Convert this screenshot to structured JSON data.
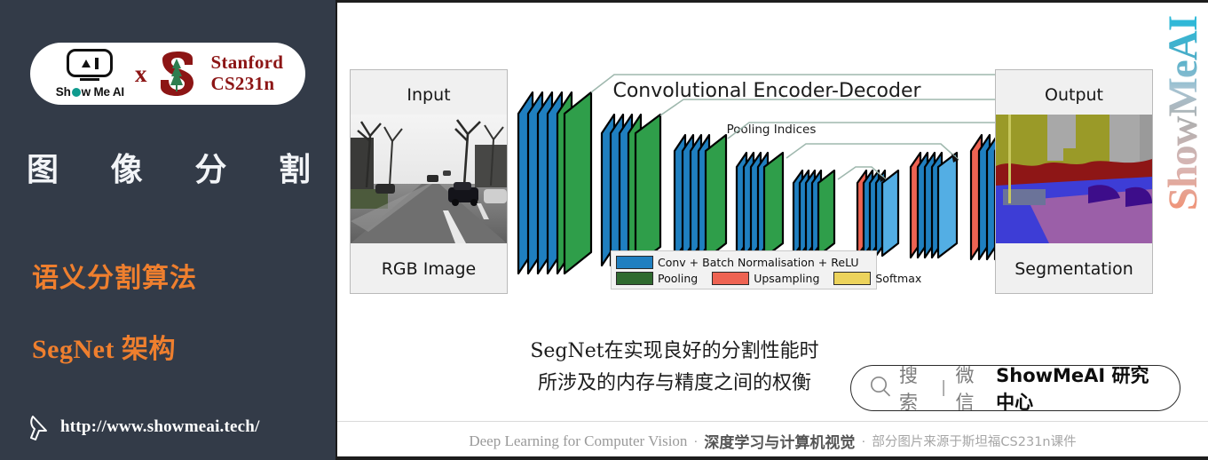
{
  "sidebar": {
    "logo": {
      "brand_label": "Show Me AI",
      "cross_label": "x",
      "partner_line1": "Stanford",
      "partner_line2": "CS231n"
    },
    "title_chars": [
      "图",
      "像",
      "分",
      "割"
    ],
    "subtitle_1": "语义分割算法",
    "subtitle_2_en": "SegNet",
    "subtitle_2_cn": "架构",
    "url": "http://www.showmeai.tech/",
    "colors": {
      "background": "#333b48",
      "accent_orange": "#ef7f2e",
      "title_white": "#f2f4f7"
    }
  },
  "figure": {
    "input_panel": {
      "title": "Input",
      "caption": "RGB Image"
    },
    "output_panel": {
      "title": "Output",
      "caption": "Segmentation"
    },
    "encoder_decoder_title": "Convolutional Encoder-Decoder",
    "pooling_indices_title": "Pooling Indices",
    "legend": [
      {
        "label": "Conv + Batch Normalisation + ReLU",
        "color": "#1f7fc0"
      },
      {
        "label": "Pooling",
        "color": "#2f6a2f"
      },
      {
        "label": "Upsampling",
        "color": "#ee6352"
      },
      {
        "label": "Softmax",
        "color": "#ecd35c"
      }
    ]
  },
  "watermark": {
    "text": "ShowMeAI"
  },
  "caption": {
    "line1": "SegNet在实现良好的分割性能时",
    "line2": "所涉及的内存与精度之间的权衡"
  },
  "search": {
    "placeholder_label": "搜索",
    "divider": "|",
    "channel_label": "微信",
    "account_label": "ShowMeAI 研究中心"
  },
  "footer": {
    "english": "Deep Learning for Computer Vision",
    "dot1": "·",
    "chinese_bold": "深度学习与计算机视觉",
    "dot2": "·",
    "source_note": "部分图片来源于斯坦福CS231n课件"
  }
}
